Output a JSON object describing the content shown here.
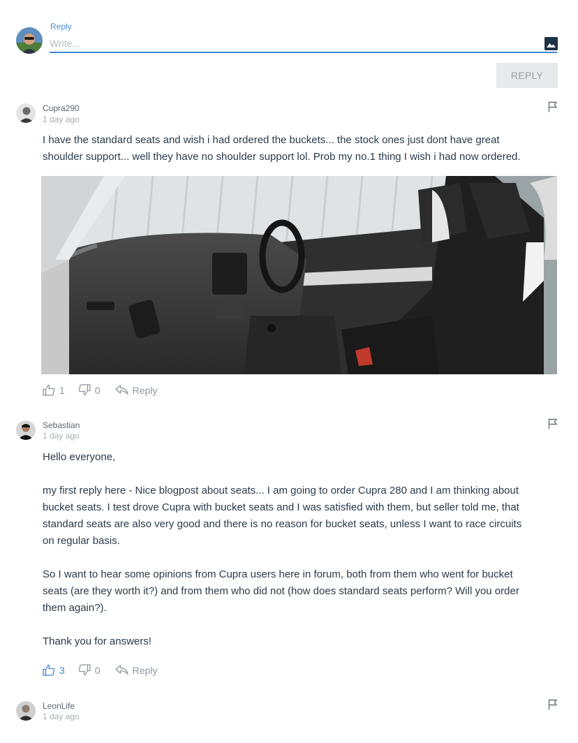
{
  "composer": {
    "label": "Reply",
    "placeholder": "Write...",
    "submit_label": "REPLY"
  },
  "comments": [
    {
      "author": "Cupra290",
      "time": "1 day ago",
      "paragraphs": [
        [
          "I have the standard seats and wish i had ordered the buckets... the stock ones just dont have great",
          "shoulder support... well they have no shoulder support lol. Prob my no.1 thing I wish i had now ordered."
        ]
      ],
      "upvotes": "1",
      "downvotes": "0",
      "reply_label": "Reply"
    },
    {
      "author": "Sebastian",
      "time": "1 day ago",
      "paragraphs": [
        [
          "Hello everyone,"
        ],
        [
          "my first reply here - Nice blogpost about seats... I am going to order Cupra 280 and I am thinking about",
          "bucket seats. I test drove Cupra with bucket seats and I was satisfied with them, but seller told me, that",
          "standard seats are also very good and there is no reason for bucket seats, unless I want to race circuits",
          "on regular basis."
        ],
        [
          "So I want to hear some opinions from Cupra users here in forum, both from them who went for bucket",
          "seats (are they worth it?) and from them who did not (how does standard seats perform? Will you order",
          "them again?)."
        ],
        [
          "Thank you for answers!"
        ]
      ],
      "upvotes": "3",
      "downvotes": "0",
      "reply_label": "Reply"
    },
    {
      "author": "LeonLife",
      "time": "1 day ago"
    }
  ],
  "colors": {
    "accent": "#3d86cf",
    "text": "#2b3a4a",
    "muted": "#8c959e"
  },
  "icons": [
    "image-icon",
    "flag-icon",
    "thumbs-up-icon",
    "thumbs-down-icon",
    "reply-arrow-icon"
  ]
}
